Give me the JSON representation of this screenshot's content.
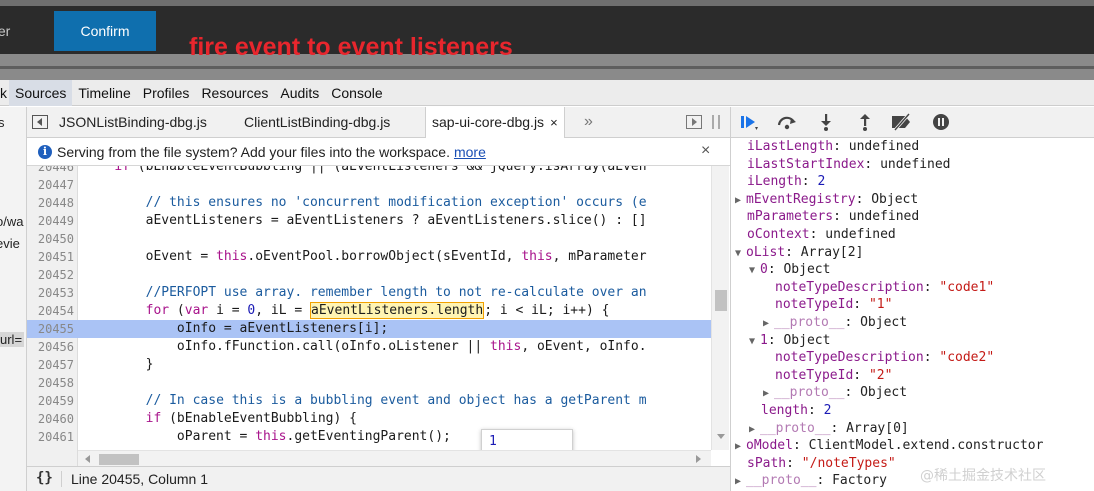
{
  "app": {
    "left_partial_label": "ter",
    "confirm_label": "Confirm",
    "annotation": "fire event to event listeners"
  },
  "panel_tabs": {
    "first_partial": "k",
    "items": [
      "Sources",
      "Timeline",
      "Profiles",
      "Resources",
      "Audits",
      "Console"
    ],
    "active": "Sources"
  },
  "navigator": {
    "items": [
      "s",
      "o/wa",
      "evie",
      "url="
    ]
  },
  "file_tabs": {
    "items": [
      "JSONListBinding-dbg.js",
      "ClientListBinding-dbg.js",
      "sap-ui-core-dbg.js"
    ],
    "active": "sap-ui-core-dbg.js",
    "close_glyph": "×",
    "more_glyph": "»"
  },
  "infobar": {
    "message": "Serving from the file system? Add your files into the workspace.",
    "link": "more",
    "close_glyph": "×"
  },
  "editor": {
    "lines": [
      {
        "n": "20446",
        "text": "    if (bEnableEventBubbling || (aEventListeners && jQuery.isArray(aEven"
      },
      {
        "n": "20447",
        "text": ""
      },
      {
        "n": "20448",
        "text": "        // this ensures no 'concurrent modification exception' occurs (e"
      },
      {
        "n": "20449",
        "text": "        aEventListeners = aEventListeners ? aEventListeners.slice() : []"
      },
      {
        "n": "20450",
        "text": ""
      },
      {
        "n": "20451",
        "text": "        oEvent = this.oEventPool.borrowObject(sEventId, this, mParameter"
      },
      {
        "n": "20452",
        "text": ""
      },
      {
        "n": "20453",
        "text": "        //PERFOPT use array. remember length to not re-calculate over an"
      },
      {
        "n": "20454",
        "text": "        for (var i = 0, iL = aEventListeners.length; i < iL; i++) {"
      },
      {
        "n": "20455",
        "text": "            oInfo = aEventListeners[i];"
      },
      {
        "n": "20456",
        "text": "            oInfo.fFunction.call(oInfo.oListener || this, oEvent, oInfo."
      },
      {
        "n": "20457",
        "text": "        }"
      },
      {
        "n": "20458",
        "text": ""
      },
      {
        "n": "20459",
        "text": "        // In case this is a bubbling event and object has a getParent m"
      },
      {
        "n": "20460",
        "text": "        if (bEnableEventBubbling) {"
      },
      {
        "n": "20461",
        "text": "            oParent = this.getEventingParent();"
      },
      {
        "n": "20462",
        "text": ""
      }
    ],
    "highlighted_expression": "aEventListeners.length",
    "tooltip_value": "1",
    "execution_line": "20455"
  },
  "statusbar": {
    "braces": "{}",
    "cursor": "Line 20455, Column 1"
  },
  "debugger_toolbar": {
    "buttons": [
      "resume-icon",
      "step-over-icon",
      "step-into-icon",
      "step-out-icon",
      "deactivate-breakpoints-icon",
      "pause-on-exceptions-icon"
    ]
  },
  "scope": {
    "rows": [
      {
        "indent": 0,
        "tri": "",
        "key": "iLastLength",
        "sep": ": ",
        "value": "undefined",
        "vtype": "plain"
      },
      {
        "indent": 0,
        "tri": "",
        "key": "iLastStartIndex",
        "sep": ": ",
        "value": "undefined",
        "vtype": "plain"
      },
      {
        "indent": 0,
        "tri": "",
        "key": "iLength",
        "sep": ": ",
        "value": "2",
        "vtype": "num"
      },
      {
        "indent": 0,
        "tri": "▶",
        "key": "mEventRegistry",
        "sep": ": ",
        "value": "Object",
        "vtype": "plain"
      },
      {
        "indent": 0,
        "tri": "",
        "key": "mParameters",
        "sep": ": ",
        "value": "undefined",
        "vtype": "plain"
      },
      {
        "indent": 0,
        "tri": "",
        "key": "oContext",
        "sep": ": ",
        "value": "undefined",
        "vtype": "plain"
      },
      {
        "indent": 0,
        "tri": "▼",
        "key": "oList",
        "sep": ": ",
        "value": "Array[2]",
        "vtype": "plain"
      },
      {
        "indent": 1,
        "tri": "▼",
        "key": "0",
        "sep": ": ",
        "value": "Object",
        "vtype": "plain"
      },
      {
        "indent": 2,
        "tri": "",
        "key": "noteTypeDescription",
        "sep": ": ",
        "value": "\"code1\"",
        "vtype": "str"
      },
      {
        "indent": 2,
        "tri": "",
        "key": "noteTypeId",
        "sep": ": ",
        "value": "\"1\"",
        "vtype": "str"
      },
      {
        "indent": 2,
        "tri": "▶",
        "key": "__proto__",
        "sep": ": ",
        "value": "Object",
        "vtype": "plain",
        "dim": true
      },
      {
        "indent": 1,
        "tri": "▼",
        "key": "1",
        "sep": ": ",
        "value": "Object",
        "vtype": "plain"
      },
      {
        "indent": 2,
        "tri": "",
        "key": "noteTypeDescription",
        "sep": ": ",
        "value": "\"code2\"",
        "vtype": "str"
      },
      {
        "indent": 2,
        "tri": "",
        "key": "noteTypeId",
        "sep": ": ",
        "value": "\"2\"",
        "vtype": "str"
      },
      {
        "indent": 2,
        "tri": "▶",
        "key": "__proto__",
        "sep": ": ",
        "value": "Object",
        "vtype": "plain",
        "dim": true
      },
      {
        "indent": 1,
        "tri": "",
        "key": "length",
        "sep": ": ",
        "value": "2",
        "vtype": "num"
      },
      {
        "indent": 1,
        "tri": "▶",
        "key": "__proto__",
        "sep": ": ",
        "value": "Array[0]",
        "vtype": "plain",
        "dim": true
      },
      {
        "indent": 0,
        "tri": "▶",
        "key": "oModel",
        "sep": ": ",
        "value": "ClientModel.extend.constructor",
        "vtype": "plain"
      },
      {
        "indent": 0,
        "tri": "",
        "key": "sPath",
        "sep": ": ",
        "value": "\"/noteTypes\"",
        "vtype": "str"
      },
      {
        "indent": 0,
        "tri": "▶",
        "key": "__proto__",
        "sep": ": ",
        "value": "Factory",
        "vtype": "plain",
        "dim": true
      }
    ]
  },
  "watermark": "@稀土掘金技术社区",
  "colors": {
    "confirm": "#0f6fae",
    "annotation": "#e8262d",
    "exec_line": "#aac3f5",
    "keyword": "#a8138b",
    "comment": "#1b5b9e",
    "property_key": "#8b1a8b",
    "string": "#c41a16",
    "number": "#1a1ab5"
  }
}
